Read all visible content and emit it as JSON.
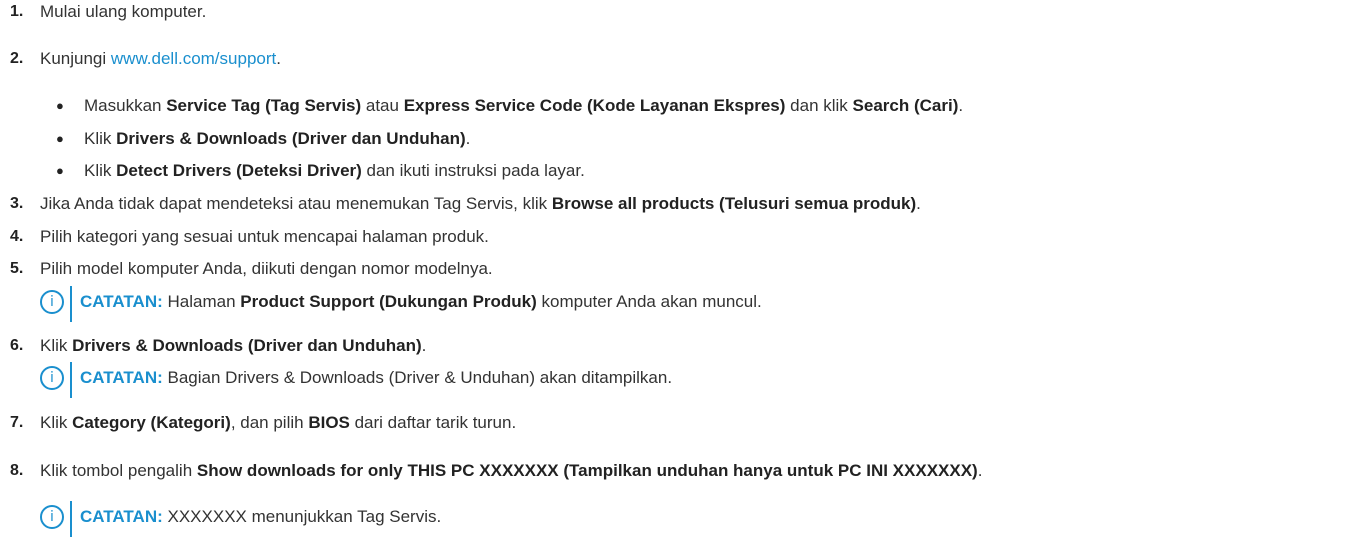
{
  "steps": [
    {
      "num": "1.",
      "parts": [
        {
          "t": "Mulai ulang komputer."
        }
      ]
    },
    {
      "num": "2.",
      "parts": [
        {
          "t": "Kunjungi "
        },
        {
          "t": "www.dell.com/support",
          "link": true
        },
        {
          "t": "."
        }
      ]
    },
    {
      "num": "3.",
      "parts": [
        {
          "t": "Jika Anda tidak dapat mendeteksi atau menemukan Tag Servis, klik "
        },
        {
          "t": "Browse all products (Telusuri semua produk)",
          "b": true
        },
        {
          "t": "."
        }
      ]
    },
    {
      "num": "4.",
      "parts": [
        {
          "t": "Pilih kategori yang sesuai untuk mencapai halaman produk."
        }
      ]
    },
    {
      "num": "5.",
      "parts": [
        {
          "t": "Pilih model komputer Anda, diikuti dengan nomor modelnya."
        }
      ]
    },
    {
      "num": "6.",
      "parts": [
        {
          "t": "Klik "
        },
        {
          "t": "Drivers & Downloads (Driver dan Unduhan)",
          "b": true
        },
        {
          "t": "."
        }
      ]
    },
    {
      "num": "7.",
      "parts": [
        {
          "t": "Klik "
        },
        {
          "t": "Category (Kategori)",
          "b": true
        },
        {
          "t": ", dan pilih "
        },
        {
          "t": "BIOS",
          "b": true
        },
        {
          "t": " dari daftar tarik turun."
        }
      ]
    },
    {
      "num": "8.",
      "parts": [
        {
          "t": "Klik tombol pengalih "
        },
        {
          "t": "Show downloads for only THIS PC XXXXXXX (Tampilkan unduhan hanya untuk PC INI XXXXXXX)",
          "b": true
        },
        {
          "t": "."
        }
      ]
    }
  ],
  "bullets": [
    {
      "parts": [
        {
          "t": "Masukkan "
        },
        {
          "t": "Service Tag (Tag Servis)",
          "b": true
        },
        {
          "t": " atau "
        },
        {
          "t": "Express Service Code (Kode Layanan Ekspres)",
          "b": true
        },
        {
          "t": " dan klik "
        },
        {
          "t": "Search (Cari)",
          "b": true
        },
        {
          "t": "."
        }
      ]
    },
    {
      "parts": [
        {
          "t": "Klik "
        },
        {
          "t": "Drivers & Downloads (Driver dan Unduhan)",
          "b": true
        },
        {
          "t": "."
        }
      ]
    },
    {
      "parts": [
        {
          "t": "Klik "
        },
        {
          "t": "Detect Drivers (Deteksi Driver)",
          "b": true
        },
        {
          "t": " dan ikuti instruksi pada layar."
        }
      ]
    }
  ],
  "notes": [
    {
      "label": "CATATAN:",
      "parts": [
        {
          "t": " Halaman "
        },
        {
          "t": "Product Support (Dukungan Produk)",
          "b": true
        },
        {
          "t": " komputer Anda akan muncul."
        }
      ]
    },
    {
      "label": "CATATAN:",
      "parts": [
        {
          "t": " Bagian Drivers & Downloads (Driver & Unduhan) akan ditampilkan."
        }
      ]
    },
    {
      "label": "CATATAN:",
      "parts": [
        {
          "t": " XXXXXXX menunjukkan Tag Servis."
        }
      ]
    }
  ],
  "bullet_glyph": "●",
  "info_icon_glyph": "i",
  "link_color": "#1a8fce"
}
